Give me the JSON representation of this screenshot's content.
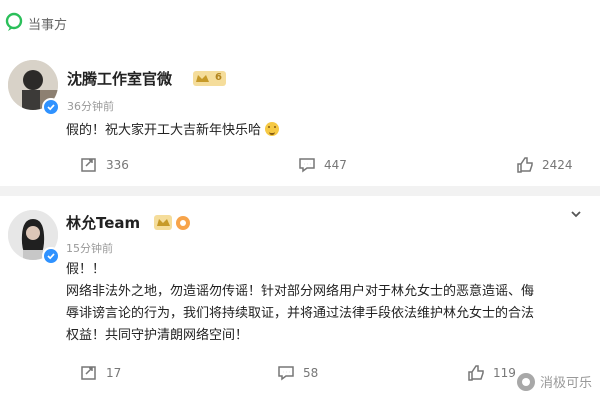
{
  "source": {
    "label": "当事方",
    "logo_icon": "message-bubble-icon",
    "accent_color": "#2bbf5a"
  },
  "post1": {
    "author": "沈腾工作室官微",
    "vip_level": "6",
    "time": "36分钟前",
    "text": "假的！祝大家开工大吉新年快乐哈",
    "reposts": "336",
    "comments": "447",
    "likes": "2424"
  },
  "post2": {
    "author": "林允Team",
    "time": "15分钟前",
    "text_lines": [
      "假！！",
      "网络非法外之地，勿造谣勿传谣！针对部分网络用户对于林允女士的恶意造谣、侮",
      "辱诽谤言论的行为，我们将持续取证，并将通过法律手段依法维护林允女士的合法",
      "权益！共同守护清朗网络空间！"
    ],
    "reposts": "17",
    "comments": "58",
    "likes": "119"
  },
  "watermark": {
    "text": "消极可乐"
  }
}
